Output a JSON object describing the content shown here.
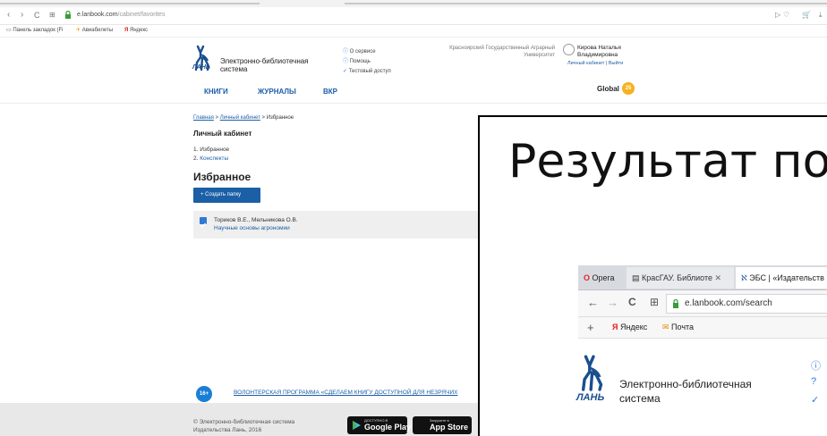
{
  "browser": {
    "url_host": "e.lanbook.com",
    "url_path": "/cabinet/favorites",
    "bookmarks": [
      {
        "label": "Панель закладок (Fi"
      },
      {
        "label": "Авиабилеты"
      },
      {
        "label": "Яндекс"
      }
    ]
  },
  "site": {
    "title_line1": "Электронно-библиотечная",
    "title_line2": "система",
    "logo_text": "ЛАНЬ",
    "links": [
      "О сервисе",
      "Помощь",
      "Тестовый доступ"
    ],
    "university_line1": "Красноярский Государственный Аграрный",
    "university_line2": "Университет",
    "user_line1": "Кирова Наталья",
    "user_line2": "Владимировна",
    "user_links": "Личный кабинет | Выйти",
    "nav": [
      "КНИГИ",
      "ЖУРНАЛЫ",
      "ВКР"
    ],
    "global_label": "Global",
    "global_badge": "25"
  },
  "page": {
    "breadcrumb": {
      "home": "Главная",
      "sep1": ">",
      "cabinet": "Личный кабинет",
      "sep2": ">",
      "current": "Избранное"
    },
    "section_title": "Личный кабинет",
    "menu": [
      {
        "num": "1.",
        "label": "Избранное"
      },
      {
        "num": "2.",
        "label": "Конспекты"
      }
    ],
    "heading": "Избранное",
    "create_button": "+ Создать папку",
    "favorite": {
      "authors": "Ториков В.Е., Мельникова О.В.",
      "title": "Научные основы агрономии"
    }
  },
  "banner": {
    "badge": "16+",
    "text": "ВОЛОНТЕРСКАЯ ПРОГРАММА «СДЕЛАЕМ КНИГУ ДОСТУПНОЙ ДЛЯ НЕЗРЯЧИХ"
  },
  "footer": {
    "copyright_line1": "© Электронно-библиотечная система",
    "copyright_line2": "Издательства Лань, 2016",
    "google_small": "ДОСТУПНО В",
    "google": "Google Play",
    "apple_small": "Загрузите в",
    "apple": "App Store"
  },
  "overlay": {
    "big_text": "Результат по",
    "opera_label": "Opera",
    "tab1": "КрасГАУ. Библиоте",
    "tab2": "ЭБС | «Издательств",
    "address": "e.lanbook.com/search",
    "bm1": "Яндекс",
    "bm2": "Почта",
    "site_title_line1": "Электронно-библиотечная",
    "site_title_line2": "система",
    "logo_text": "ЛАНЬ"
  }
}
